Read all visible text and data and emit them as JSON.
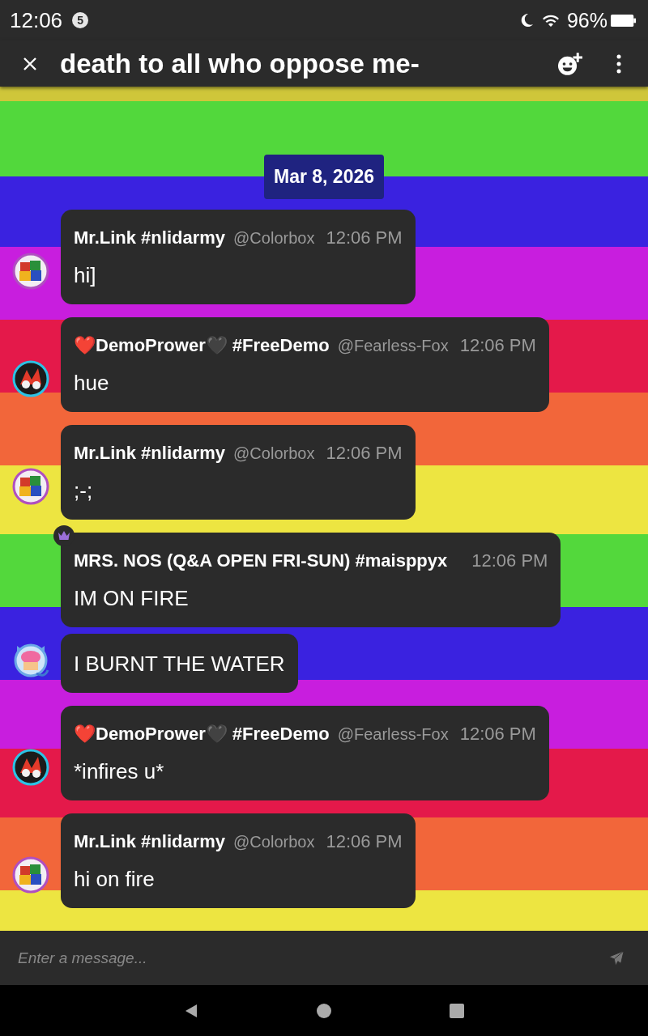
{
  "status_bar": {
    "time": "12:06",
    "notification_count": "5",
    "battery": "96%"
  },
  "app_bar": {
    "title": "death to all who oppose me-"
  },
  "date_divider": "Mar 8, 2026",
  "messages": [
    {
      "author": "Mr.Link #nlidarmy",
      "handle": "@Colorbox",
      "time": "12:06 PM",
      "crown": false,
      "bubbles": [
        "hi]"
      ]
    },
    {
      "author": "❤️DemoPrower🖤 #FreeDemo",
      "handle": "@Fearless-Fox",
      "time": "12:06 PM",
      "crown": false,
      "bubbles": [
        "hue"
      ]
    },
    {
      "author": "Mr.Link #nlidarmy",
      "handle": "@Colorbox",
      "time": "12:06 PM",
      "crown": false,
      "bubbles": [
        ";-;"
      ]
    },
    {
      "author": "MRS. NOS (Q&A OPEN FRI-SUN) #maisppyx",
      "time": "12:06 PM",
      "crown": true,
      "bubbles": [
        "IM ON FIRE",
        "I BURNT THE WATER"
      ]
    },
    {
      "author": "❤️DemoPrower🖤 #FreeDemo",
      "handle": "@Fearless-Fox",
      "time": "12:06 PM",
      "crown": false,
      "bubbles": [
        "*infires u*"
      ]
    },
    {
      "author": "Mr.Link #nlidarmy",
      "handle": "@Colorbox",
      "time": "12:06 PM",
      "crown": false,
      "bubbles": [
        "hi on fire"
      ]
    }
  ],
  "composer": {
    "placeholder": "Enter a message..."
  }
}
